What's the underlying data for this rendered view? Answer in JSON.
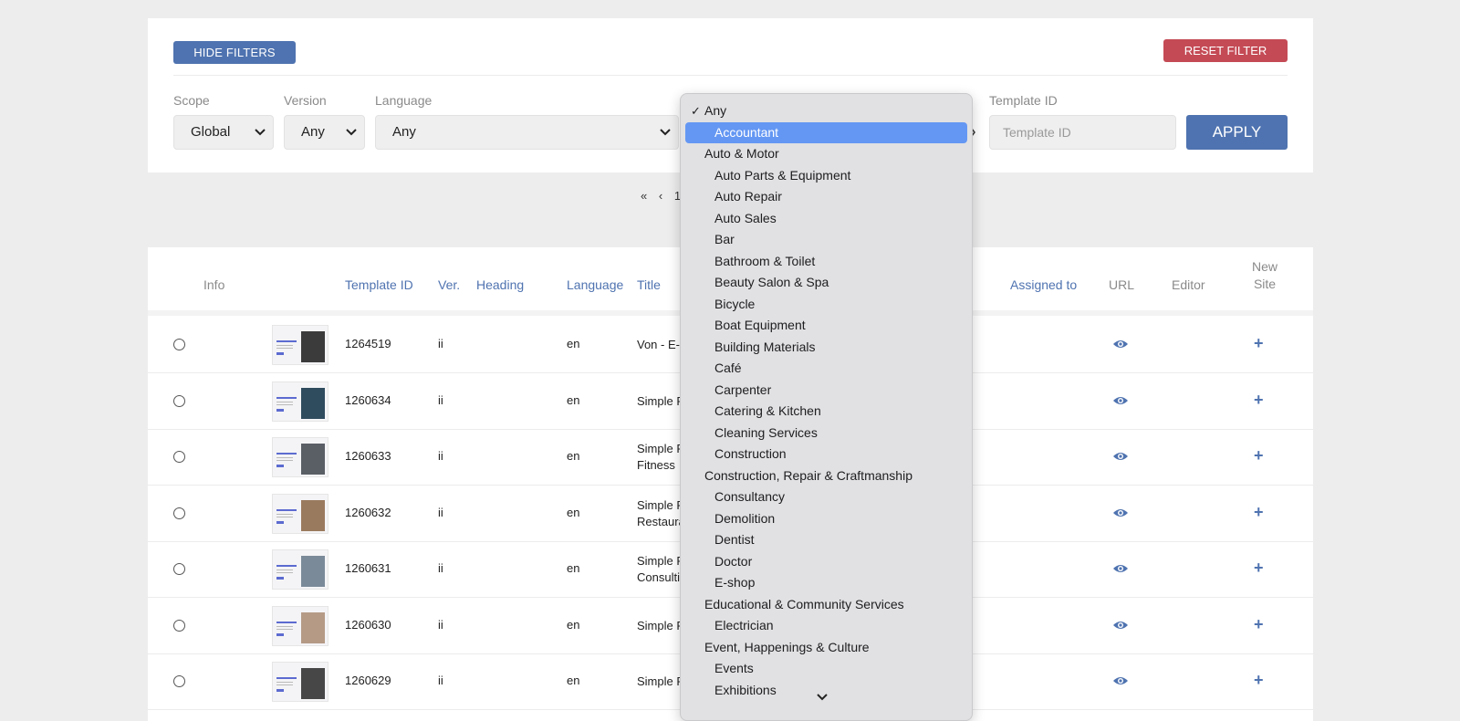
{
  "filters": {
    "hide_label": "HIDE FILTERS",
    "reset_label": "RESET FILTER",
    "scope_label": "Scope",
    "scope_value": "Global",
    "version_label": "Version",
    "version_value": "Any",
    "language_label": "Language",
    "language_value": "Any",
    "template_id_label": "Template ID",
    "template_id_placeholder": "Template ID",
    "apply_label": "APPLY"
  },
  "pagination": {
    "first": "«",
    "prev": "‹",
    "page": "1"
  },
  "table": {
    "headers": {
      "info": "Info",
      "template_id": "Template ID",
      "ver": "Ver.",
      "heading": "Heading",
      "language": "Language",
      "title": "Title",
      "assigned_to": "Assigned to",
      "url": "URL",
      "editor": "Editor",
      "new_site_1": "New",
      "new_site_2": "Site"
    },
    "rows": [
      {
        "id": "1264519",
        "ver": "ii",
        "lang": "en",
        "title": "Von - E-c",
        "title2": ""
      },
      {
        "id": "1260634",
        "ver": "ii",
        "lang": "en",
        "title": "Simple F",
        "title2": ""
      },
      {
        "id": "1260633",
        "ver": "ii",
        "lang": "en",
        "title": "Simple F",
        "title2": "Fitness"
      },
      {
        "id": "1260632",
        "ver": "ii",
        "lang": "en",
        "title": "Simple F",
        "title2": "Restaura"
      },
      {
        "id": "1260631",
        "ver": "ii",
        "lang": "en",
        "title": "Simple F",
        "title2": "Consulti"
      },
      {
        "id": "1260630",
        "ver": "ii",
        "lang": "en",
        "title": "Simple F",
        "title2": ""
      },
      {
        "id": "1260629",
        "ver": "ii",
        "lang": "en",
        "title": "Simple F",
        "title2": ""
      }
    ],
    "eye_icon": "eye-icon",
    "plus_icon": "plus-icon"
  },
  "dropdown": {
    "checked": "Any",
    "selected": "Accountant",
    "options": [
      {
        "label": "Any",
        "level": 0,
        "checked": true
      },
      {
        "label": "Accountant",
        "level": 1,
        "selected": true
      },
      {
        "label": "Auto & Motor",
        "level": 0
      },
      {
        "label": "Auto Parts & Equipment",
        "level": 1
      },
      {
        "label": "Auto Repair",
        "level": 1
      },
      {
        "label": "Auto Sales",
        "level": 1
      },
      {
        "label": "Bar",
        "level": 1
      },
      {
        "label": "Bathroom & Toilet",
        "level": 1
      },
      {
        "label": "Beauty Salon & Spa",
        "level": 1
      },
      {
        "label": "Bicycle",
        "level": 1
      },
      {
        "label": "Boat Equipment",
        "level": 1
      },
      {
        "label": "Building Materials",
        "level": 1
      },
      {
        "label": "Café",
        "level": 1
      },
      {
        "label": "Carpenter",
        "level": 1
      },
      {
        "label": "Catering & Kitchen",
        "level": 1
      },
      {
        "label": "Cleaning Services",
        "level": 1
      },
      {
        "label": "Construction",
        "level": 1
      },
      {
        "label": "Construction, Repair & Craftmanship",
        "level": 0
      },
      {
        "label": "Consultancy",
        "level": 1
      },
      {
        "label": "Demolition",
        "level": 1
      },
      {
        "label": "Dentist",
        "level": 1
      },
      {
        "label": "Doctor",
        "level": 1
      },
      {
        "label": "E-shop",
        "level": 1
      },
      {
        "label": "Educational & Community Services",
        "level": 0
      },
      {
        "label": "Electrician",
        "level": 1
      },
      {
        "label": "Event, Happenings & Culture",
        "level": 0
      },
      {
        "label": "Events",
        "level": 1
      },
      {
        "label": "Exhibitions",
        "level": 1
      }
    ],
    "accent": "#6497f3"
  },
  "colors": {
    "primary": "#4f73b0",
    "danger": "#c44a55"
  }
}
